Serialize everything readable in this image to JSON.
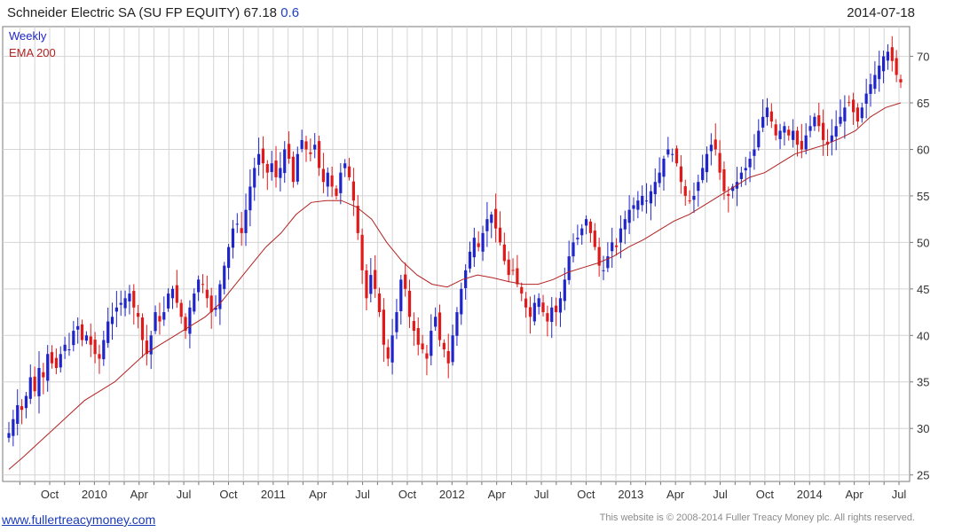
{
  "header": {
    "security": "Schneider Electric SA (SU FP EQUITY)",
    "last_price": "67.18",
    "change": "0.6",
    "date": "2014-07-18"
  },
  "legend": {
    "series_label": "Weekly",
    "ema_label": "EMA 200"
  },
  "footer": {
    "website": "www.fullertreacymoney.com",
    "copyright": "This website is © 2008-2014 Fuller Treacy Money plc. All rights reserved."
  },
  "colors": {
    "up": "#1f25c9",
    "down": "#e01a1a",
    "ema": "#b22222",
    "grid": "#d4d4d4",
    "frame": "#7a7a7a"
  },
  "chart_data": {
    "type": "candlestick",
    "frequency": "weekly",
    "x_tick_labels": [
      "Oct",
      "2010",
      "Apr",
      "Jul",
      "Oct",
      "2011",
      "Apr",
      "Jul",
      "Oct",
      "2012",
      "Apr",
      "Jul",
      "Oct",
      "2013",
      "Apr",
      "Jul",
      "Oct",
      "2014",
      "Apr",
      "Jul"
    ],
    "y_ticks": [
      25,
      30,
      35,
      40,
      45,
      50,
      55,
      60,
      65,
      70
    ],
    "ylim": [
      24.3,
      73.2
    ],
    "grid": true,
    "legend_position": "top-left",
    "ema_period": 200,
    "approx_weekly_close": [
      29.5,
      31.0,
      32.5,
      32.0,
      33.5,
      35.5,
      34.0,
      36.5,
      35.5,
      38.0,
      37.0,
      36.5,
      38.0,
      39.0,
      38.5,
      40.5,
      41.0,
      39.5,
      40.0,
      39.0,
      38.0,
      37.5,
      39.5,
      41.5,
      42.0,
      43.0,
      43.5,
      44.0,
      44.5,
      43.0,
      42.0,
      39.5,
      38.0,
      40.0,
      42.5,
      41.5,
      42.5,
      44.5,
      45.0,
      43.5,
      42.0,
      40.5,
      43.0,
      44.5,
      46.0,
      45.5,
      44.0,
      42.5,
      43.0,
      45.5,
      47.5,
      49.5,
      51.5,
      52.0,
      51.0,
      53.5,
      56.0,
      58.0,
      59.5,
      58.5,
      57.5,
      58.5,
      57.0,
      58.0,
      60.0,
      59.0,
      56.5,
      59.5,
      61.0,
      60.0,
      59.5,
      60.5,
      58.0,
      56.5,
      57.5,
      56.0,
      55.0,
      57.5,
      58.5,
      57.0,
      54.5,
      51.0,
      47.0,
      44.0,
      46.5,
      45.0,
      42.5,
      39.0,
      37.5,
      40.0,
      42.5,
      46.0,
      45.0,
      42.0,
      40.5,
      39.0,
      38.5,
      37.5,
      40.5,
      42.0,
      39.5,
      38.5,
      37.0,
      40.0,
      42.5,
      45.0,
      47.0,
      49.0,
      50.5,
      49.5,
      51.0,
      52.5,
      53.0,
      51.5,
      50.0,
      48.0,
      46.5,
      47.0,
      45.5,
      44.5,
      43.0,
      42.0,
      43.5,
      44.0,
      42.5,
      41.5,
      43.0,
      42.5,
      44.0,
      46.0,
      48.5,
      50.0,
      50.5,
      51.5,
      52.5,
      51.0,
      49.5,
      47.5,
      47.0,
      48.5,
      50.0,
      49.5,
      51.5,
      52.5,
      53.5,
      54.0,
      54.5,
      55.0,
      54.5,
      55.5,
      56.5,
      57.5,
      59.0,
      60.0,
      59.5,
      58.5,
      56.5,
      55.0,
      54.5,
      55.0,
      56.5,
      58.0,
      59.5,
      60.5,
      60.0,
      57.5,
      55.5,
      55.0,
      56.0,
      56.5,
      57.5,
      58.0,
      59.0,
      60.0,
      62.0,
      63.5,
      64.5,
      63.0,
      61.5,
      62.0,
      62.5,
      61.5,
      62.0,
      60.5,
      60.0,
      61.5,
      62.5,
      63.5,
      62.5,
      61.0,
      60.5,
      61.5,
      62.5,
      63.5,
      64.5,
      65.0,
      64.0,
      63.0,
      64.5,
      66.0,
      67.0,
      68.0,
      69.0,
      70.0,
      70.5,
      69.5,
      68.0,
      67.2
    ],
    "approx_ema_200": [
      25.6,
      27.0,
      28.5,
      30.0,
      31.5,
      33.0,
      34.0,
      35.0,
      36.5,
      38.0,
      39.0,
      40.0,
      41.0,
      42.0,
      43.5,
      45.5,
      47.5,
      49.5,
      51.0,
      53.0,
      54.3,
      54.5,
      54.5,
      53.8,
      52.5,
      50.0,
      48.0,
      46.5,
      45.5,
      45.2,
      46.0,
      46.5,
      46.2,
      45.8,
      45.5,
      45.5,
      46.0,
      46.8,
      47.3,
      47.8,
      48.5,
      49.5,
      50.3,
      51.3,
      52.3,
      53.0,
      54.0,
      55.0,
      56.0,
      57.0,
      57.5,
      58.5,
      59.5,
      60.0,
      60.5,
      61.2,
      62.0,
      63.5,
      64.5,
      65.0
    ]
  }
}
